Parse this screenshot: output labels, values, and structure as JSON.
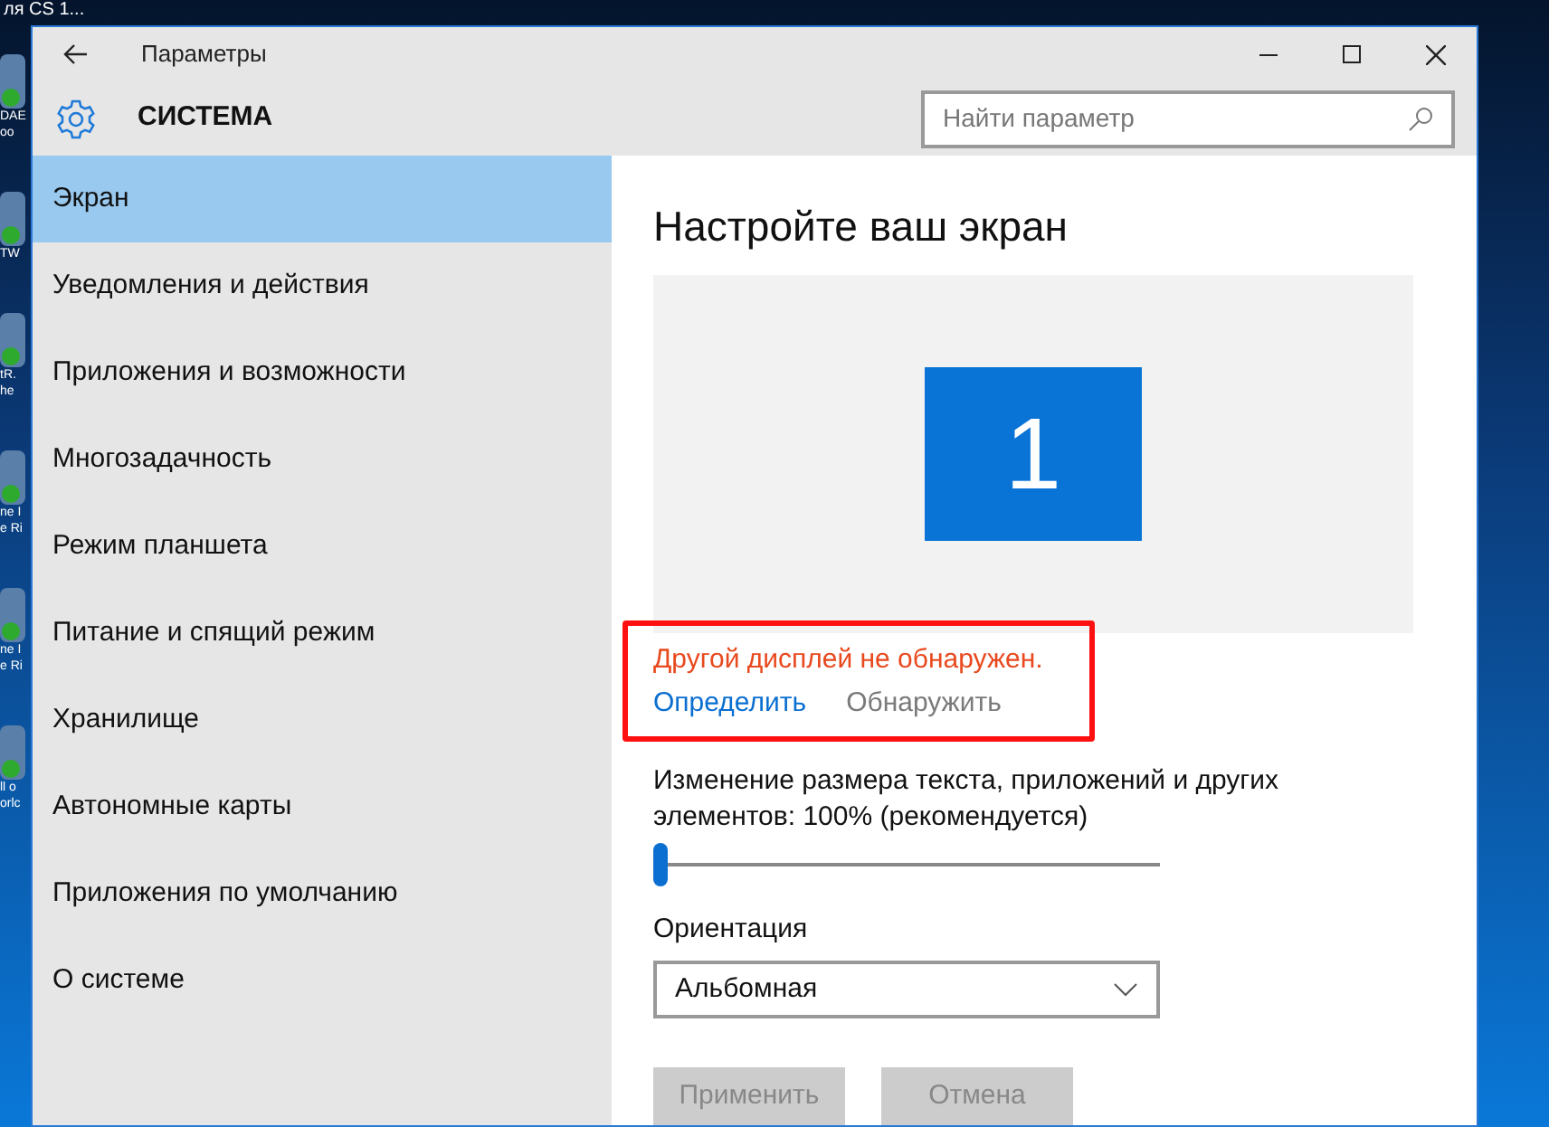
{
  "desktop": {
    "top_label": "ля CS 1...",
    "icon_labels": [
      [
        "DAE",
        "oo"
      ],
      [
        "TW"
      ],
      [
        "tR.",
        "he"
      ],
      [
        "ne I",
        "e Ri"
      ],
      [
        "ne I",
        "e Ri"
      ],
      [
        "ll o",
        "orlc"
      ]
    ]
  },
  "window": {
    "title": "Параметры"
  },
  "header": {
    "title": "СИСТЕМА",
    "search": {
      "placeholder": "Найти параметр"
    }
  },
  "sidebar": {
    "items": [
      {
        "label": "Экран",
        "selected": true
      },
      {
        "label": "Уведомления и действия",
        "selected": false
      },
      {
        "label": "Приложения и возможности",
        "selected": false
      },
      {
        "label": "Многозадачность",
        "selected": false
      },
      {
        "label": "Режим планшета",
        "selected": false
      },
      {
        "label": "Питание и спящий режим",
        "selected": false
      },
      {
        "label": "Хранилище",
        "selected": false
      },
      {
        "label": "Автономные карты",
        "selected": false
      },
      {
        "label": "Приложения по умолчанию",
        "selected": false
      },
      {
        "label": "О системе",
        "selected": false
      }
    ]
  },
  "content": {
    "title": "Настройте ваш экран",
    "display": {
      "number": "1"
    },
    "warning": "Другой дисплей не обнаружен.",
    "links": [
      {
        "label": "Определить",
        "disabled": false
      },
      {
        "label": "Обнаружить",
        "disabled": true
      }
    ],
    "scale": {
      "label": "Изменение размера текста, приложений и других элементов: 100% (рекомендуется)",
      "level": 0
    },
    "orientation": {
      "label": "Ориентация",
      "value": "Альбомная"
    },
    "buttons": [
      {
        "label": "Применить",
        "disabled": true
      },
      {
        "label": "Отмена",
        "disabled": true
      }
    ]
  }
}
